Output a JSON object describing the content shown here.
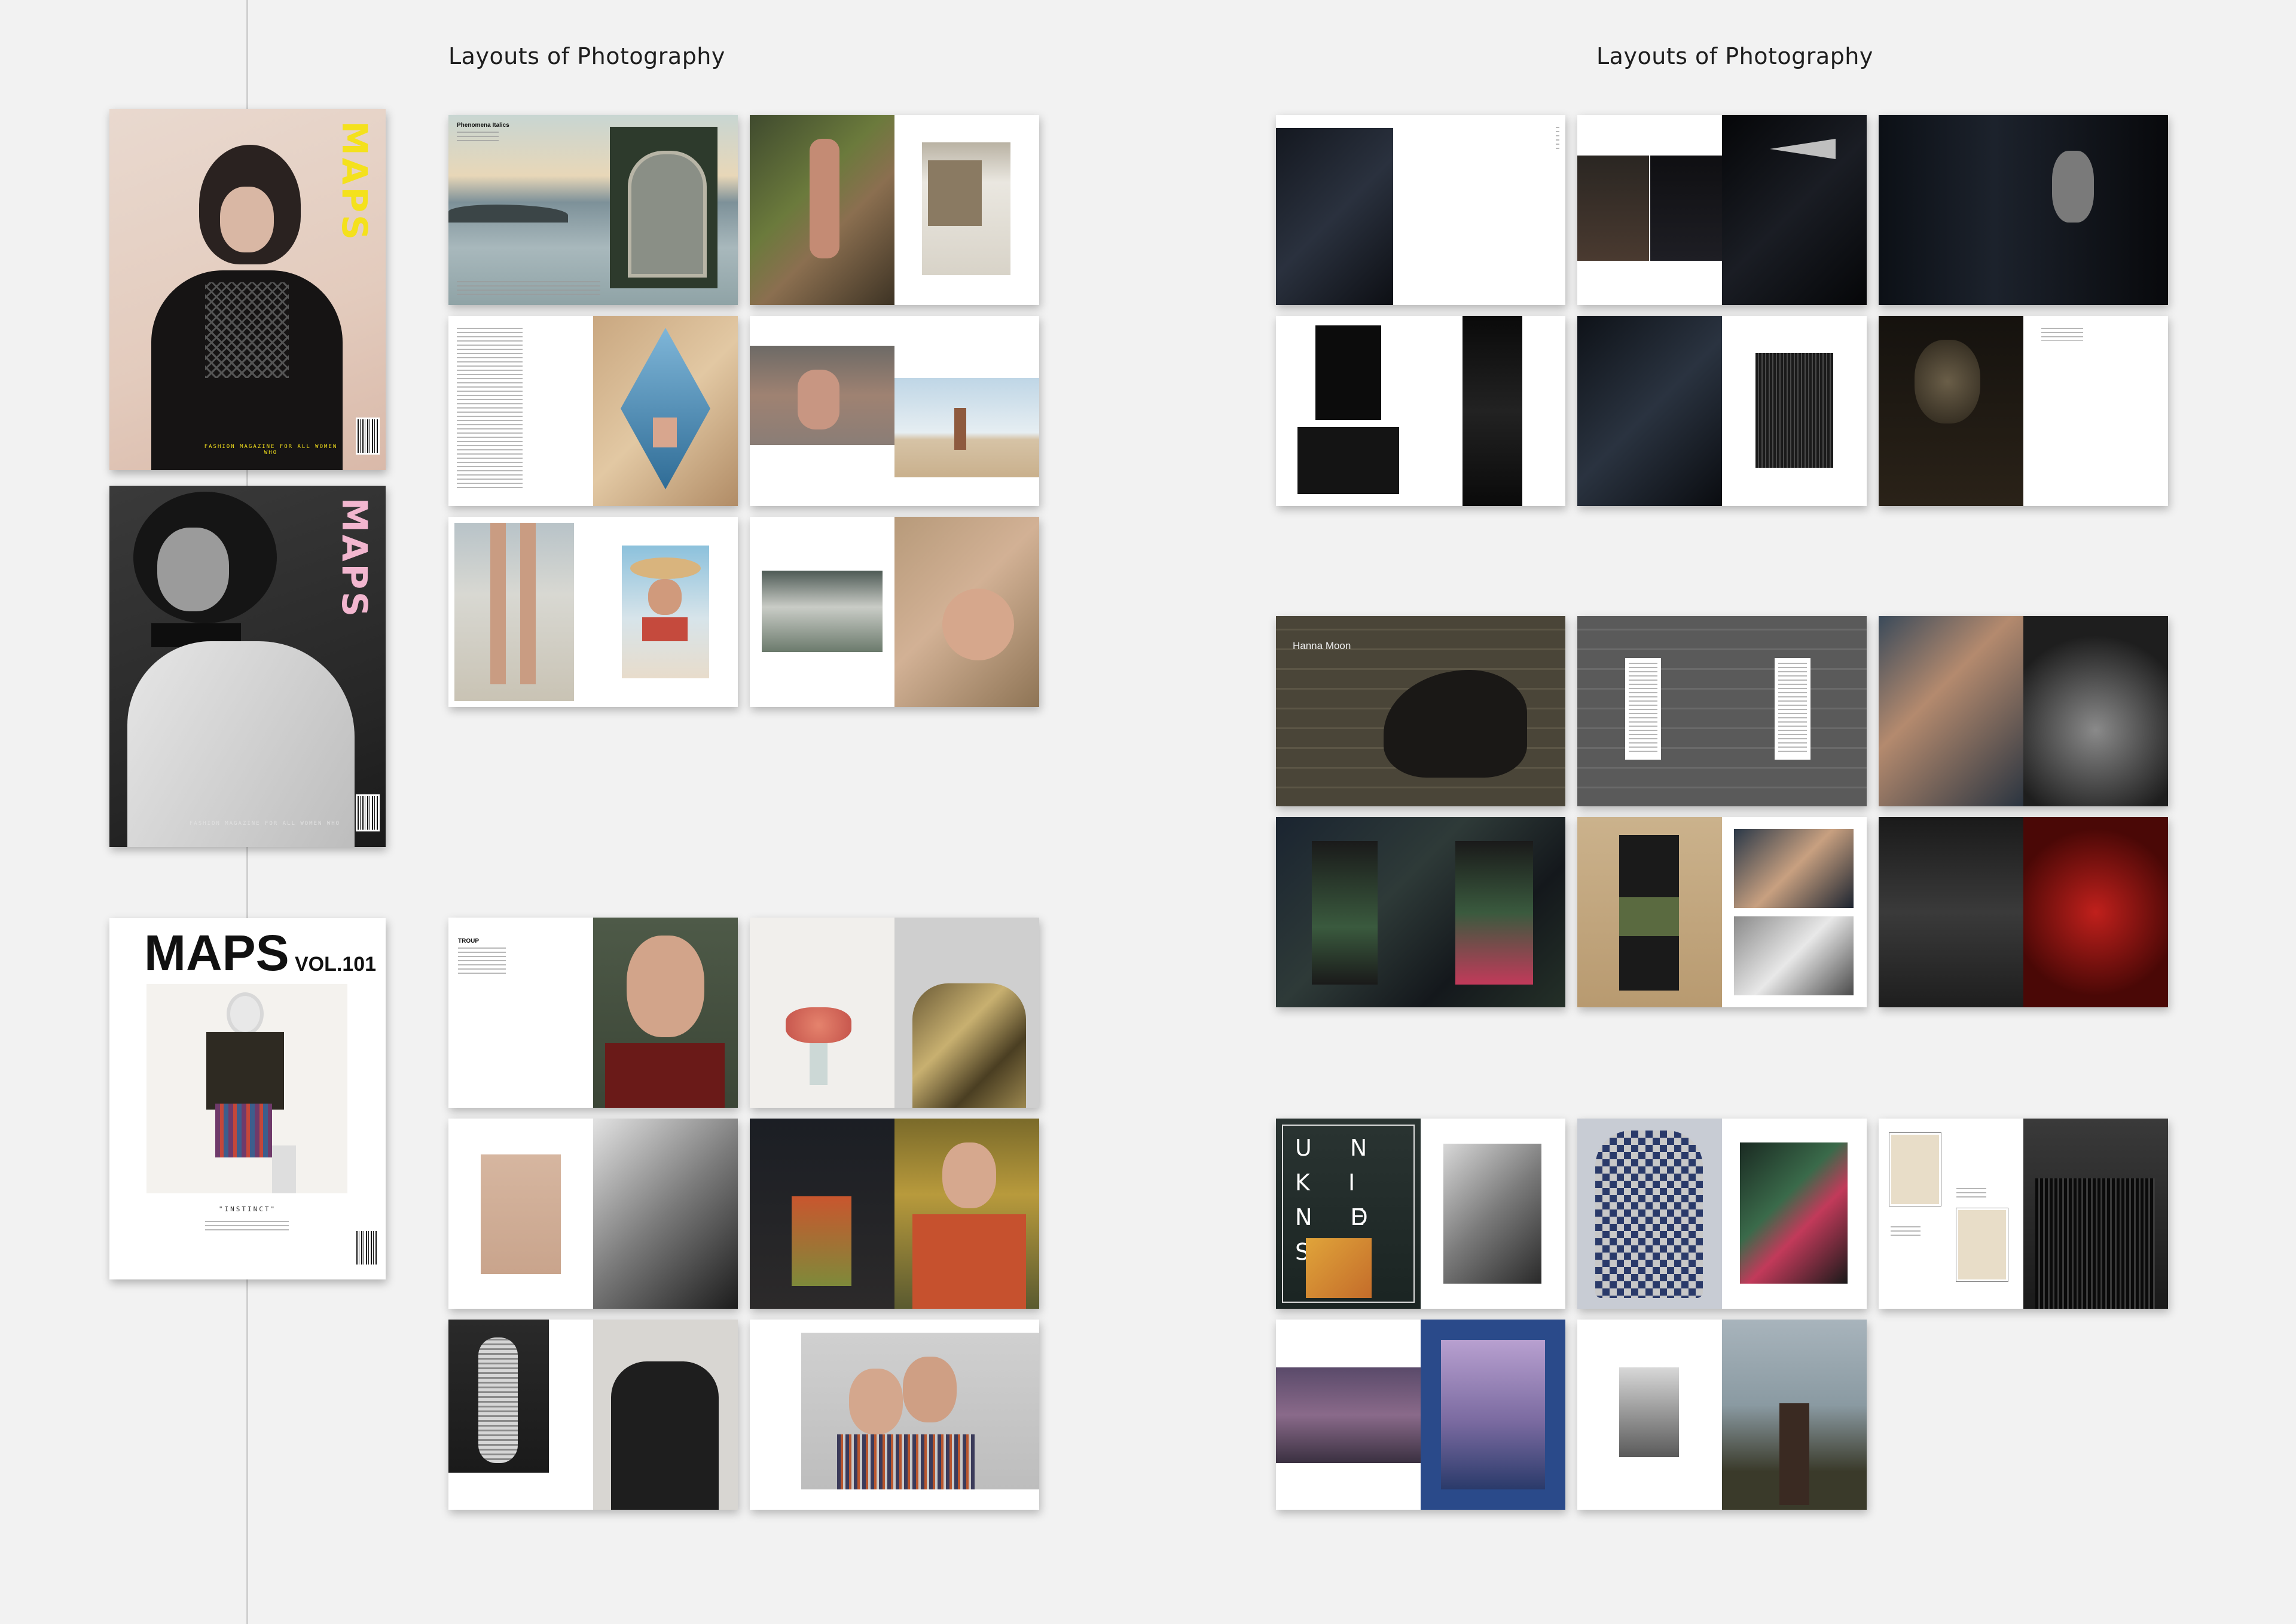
{
  "headings": {
    "left": "Layouts of Photography",
    "right": "Layouts of Photography"
  },
  "covers": {
    "cover1": {
      "logo": "MAPS",
      "subtitle": "FASHION MAGAZINE FOR ALL WOMEN WHO"
    },
    "cover2": {
      "logo": "MAPS",
      "subtitle": "FASHION MAGAZINE FOR ALL WOMEN WHO"
    },
    "cover3": {
      "logo": "MAPS",
      "volume": "VOL.101",
      "tagline": "\"INSTINCT\""
    }
  },
  "spreads": {
    "phenomena_title": "Phenomena Italics",
    "hanna_moon": "Hanna Moon",
    "troup_title": "TROUP",
    "unkindness": [
      "U N",
      "K I N D",
      "N E S S"
    ]
  },
  "colors": {
    "background": "#f2f2f2",
    "cover1_logo": "#f4e11c",
    "cover2_logo": "#f2b6cf"
  }
}
